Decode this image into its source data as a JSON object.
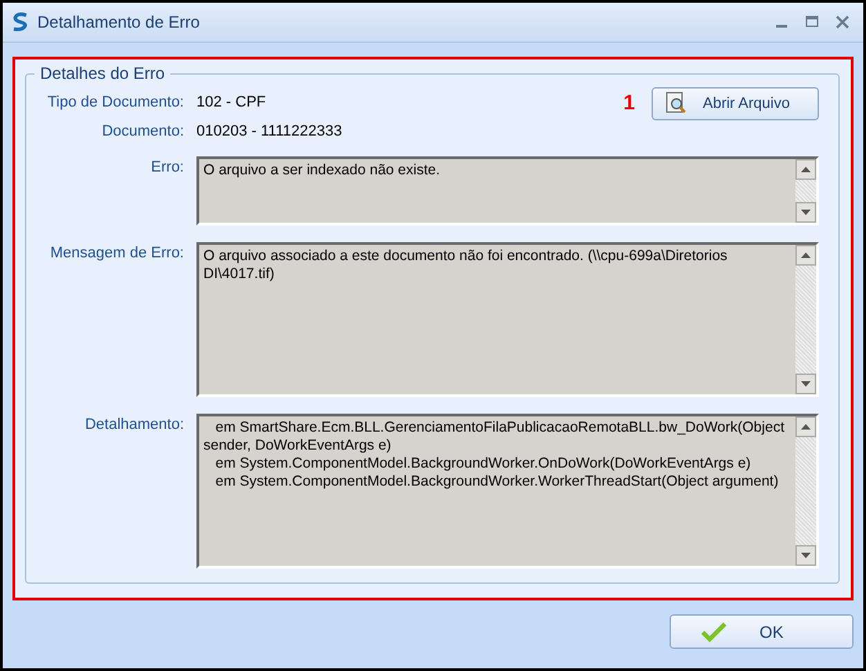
{
  "window": {
    "title": "Detalhamento de Erro"
  },
  "group": {
    "title": "Detalhes do Erro"
  },
  "annotation": "1",
  "open_button": {
    "label": "Abrir Arquivo"
  },
  "info": [
    {
      "label": "Tipo de Documento:",
      "value": "102 - CPF"
    },
    {
      "label": "Documento:",
      "value": "010203 - 1111222333"
    }
  ],
  "fields": [
    {
      "label": "Erro:",
      "lines": [
        "O arquivo a ser indexado não existe."
      ]
    },
    {
      "label": "Mensagem de Erro:",
      "lines": [
        "O arquivo associado a este documento não foi encontrado. (\\\\cpu-699a\\Diretorios",
        "DI\\4017.tif)"
      ]
    },
    {
      "label": "Detalhamento:",
      "lines": [
        "   em SmartShare.Ecm.BLL.GerenciamentoFilaPublicacaoRemotaBLL.bw_DoWork(Object",
        "sender, DoWorkEventArgs e)",
        "   em System.ComponentModel.BackgroundWorker.OnDoWork(DoWorkEventArgs e)",
        "   em System.ComponentModel.BackgroundWorker.WorkerThreadStart(Object argument)"
      ]
    }
  ],
  "ok_button": {
    "label": "OK"
  }
}
